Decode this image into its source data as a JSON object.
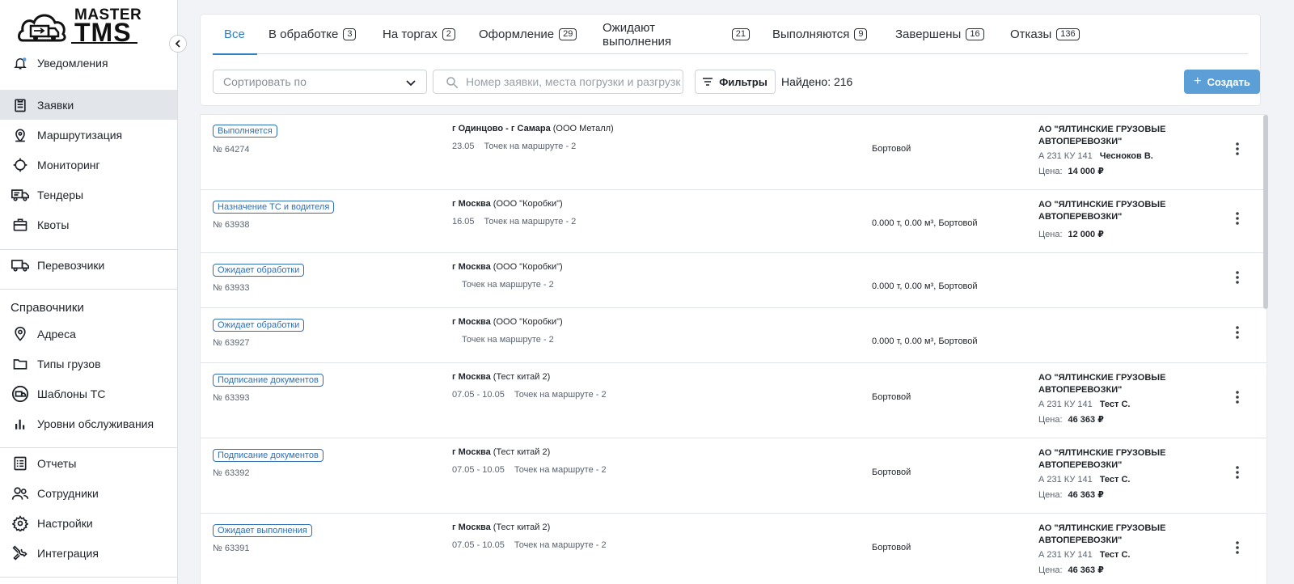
{
  "app": {
    "logo_line1": "MASTER",
    "logo_line2": "TMS"
  },
  "sidebar": {
    "notifications": "Уведомления",
    "items": [
      {
        "label": "Заявки",
        "icon": "clipboard-icon",
        "active": true
      },
      {
        "label": "Маршрутизация",
        "icon": "map-pin-icon"
      },
      {
        "label": "Мониторинг",
        "icon": "crosshair-icon"
      },
      {
        "label": "Тендеры",
        "icon": "truck-price-icon"
      },
      {
        "label": "Квоты",
        "icon": "briefcase-icon"
      },
      {
        "label": "Перевозчики",
        "icon": "truck-icon"
      }
    ],
    "section_title": "Справочники",
    "ref_items": [
      {
        "label": "Адреса",
        "icon": "location-icon"
      },
      {
        "label": "Типы грузов",
        "icon": "folder-icon"
      },
      {
        "label": "Шаблоны ТС",
        "icon": "vehicle-template-icon"
      },
      {
        "label": "Уровни обслуживания",
        "icon": "bar-chart-icon"
      }
    ],
    "bottom_items": [
      {
        "label": "Отчеты",
        "icon": "list-icon"
      },
      {
        "label": "Сотрудники",
        "icon": "users-icon"
      },
      {
        "label": "Настройки",
        "icon": "gear-icon"
      },
      {
        "label": "Интеграция",
        "icon": "wrench-icon"
      }
    ]
  },
  "tabs": [
    {
      "label": "Все",
      "count": "",
      "active": true
    },
    {
      "label": "В обработке",
      "count": "3"
    },
    {
      "label": "На торгах",
      "count": "2"
    },
    {
      "label": "Оформление",
      "count": "29"
    },
    {
      "label": "Ожидают выполнения",
      "count": "21"
    },
    {
      "label": "Выполняются",
      "count": "9"
    },
    {
      "label": "Завершены",
      "count": "16"
    },
    {
      "label": "Отказы",
      "count": "136"
    }
  ],
  "toolbar": {
    "sort_placeholder": "Сортировать по",
    "search_placeholder": "Номер заявки, места погрузки и разгрузки",
    "filters_label": "Фильтры",
    "found_label": "Найдено: 216",
    "create_label": "Создать"
  },
  "orders": [
    {
      "status": "Выполняется",
      "number": "№ 64274",
      "route_bold": "г Одинцово - г Самара",
      "route_rest": " (ООО Металл)",
      "date": "23.05",
      "points": "Точек на маршруте - 2",
      "cargo": "Бортовой",
      "carrier": "АО \"ЯЛТИНСКИЕ ГРУЗОВЫЕ АВТОПЕРЕВОЗКИ\"",
      "plate": "А 231 КУ 141",
      "driver": "Чесноков В.",
      "price_label": "Цена:",
      "price": "14 000 ₽"
    },
    {
      "status": "Назначение ТС и водителя",
      "number": "№ 63938",
      "route_bold": "г Москва",
      "route_rest": " (ООО \"Коробки\")",
      "date": "16.05",
      "points": "Точек на маршруте - 2",
      "cargo": "0.000 т, 0.00 м³, Бортовой",
      "carrier": "АО \"ЯЛТИНСКИЕ ГРУЗОВЫЕ АВТОПЕРЕВОЗКИ\"",
      "plate": "",
      "driver": "",
      "price_label": "Цена:",
      "price": "12 000 ₽"
    },
    {
      "status": "Ожидает обработки",
      "number": "№ 63933",
      "route_bold": "г Москва",
      "route_rest": " (ООО \"Коробки\")",
      "date": "",
      "points": "Точек на маршруте - 2",
      "cargo": "0.000 т, 0.00 м³, Бортовой",
      "carrier": "",
      "plate": "",
      "driver": "",
      "price_label": "",
      "price": ""
    },
    {
      "status": "Ожидает обработки",
      "number": "№ 63927",
      "route_bold": "г Москва",
      "route_rest": " (ООО \"Коробки\")",
      "date": "",
      "points": "Точек на маршруте - 2",
      "cargo": "0.000 т, 0.00 м³, Бортовой",
      "carrier": "",
      "plate": "",
      "driver": "",
      "price_label": "",
      "price": ""
    },
    {
      "status": "Подписание документов",
      "number": "№ 63393",
      "route_bold": "г Москва",
      "route_rest": " (Тест китай 2)",
      "date": "07.05 - 10.05",
      "points": "Точек на маршруте - 2",
      "cargo": "Бортовой",
      "carrier": "АО \"ЯЛТИНСКИЕ ГРУЗОВЫЕ АВТОПЕРЕВОЗКИ\"",
      "plate": "А 231 КУ 141",
      "driver": "Тест С.",
      "price_label": "Цена:",
      "price": "46 363 ₽"
    },
    {
      "status": "Подписание документов",
      "number": "№ 63392",
      "route_bold": "г Москва",
      "route_rest": " (Тест китай 2)",
      "date": "07.05 - 10.05",
      "points": "Точек на маршруте - 2",
      "cargo": "Бортовой",
      "carrier": "АО \"ЯЛТИНСКИЕ ГРУЗОВЫЕ АВТОПЕРЕВОЗКИ\"",
      "plate": "А 231 КУ 141",
      "driver": "Тест С.",
      "price_label": "Цена:",
      "price": "46 363 ₽"
    },
    {
      "status": "Ожидает выполнения",
      "number": "№ 63391",
      "route_bold": "г Москва",
      "route_rest": " (Тест китай 2)",
      "date": "07.05 - 10.05",
      "points": "Точек на маршруте - 2",
      "cargo": "Бортовой",
      "carrier": "АО \"ЯЛТИНСКИЕ ГРУЗОВЫЕ АВТОПЕРЕВОЗКИ\"",
      "plate": "А 231 КУ 141",
      "driver": "Тест С.",
      "price_label": "Цена:",
      "price": "46 363 ₽"
    }
  ],
  "colors": {
    "accent": "#2f7fc3",
    "create_button": "#5b9fd6",
    "badge": "#2f6fb3",
    "active_nav": "#e2e5ea"
  }
}
